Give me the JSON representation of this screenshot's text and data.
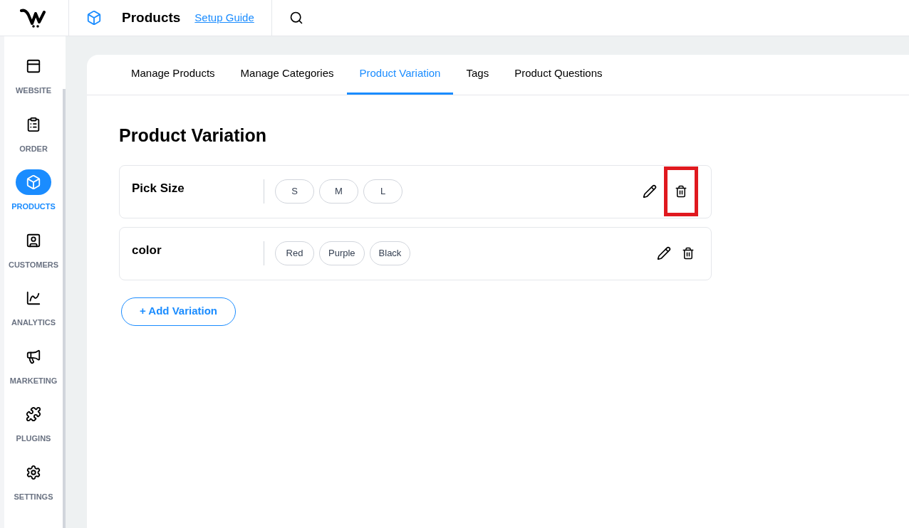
{
  "header": {
    "title": "Products",
    "link": "Setup Guide"
  },
  "sidebar": {
    "items": [
      {
        "label": "WEBSITE",
        "selected": false
      },
      {
        "label": "ORDER",
        "selected": false
      },
      {
        "label": "PRODUCTS",
        "selected": true
      },
      {
        "label": "CUSTOMERS",
        "selected": false
      },
      {
        "label": "ANALYTICS",
        "selected": false
      },
      {
        "label": "MARKETING",
        "selected": false
      },
      {
        "label": "PLUGINS",
        "selected": false
      },
      {
        "label": "SETTINGS",
        "selected": false
      }
    ]
  },
  "tabs": [
    {
      "label": "Manage Products",
      "selected": false
    },
    {
      "label": "Manage Categories",
      "selected": false
    },
    {
      "label": "Product Variation",
      "selected": true
    },
    {
      "label": "Tags",
      "selected": false
    },
    {
      "label": "Product Questions",
      "selected": false
    }
  ],
  "heading": "Product Variation",
  "variations": [
    {
      "name": "Pick Size",
      "options": [
        "S",
        "M",
        "L"
      ],
      "delete_highlighted": true
    },
    {
      "name": "color",
      "options": [
        "Red",
        "Purple",
        "Black"
      ],
      "delete_highlighted": false
    }
  ],
  "add_button": "+ Add Variation"
}
